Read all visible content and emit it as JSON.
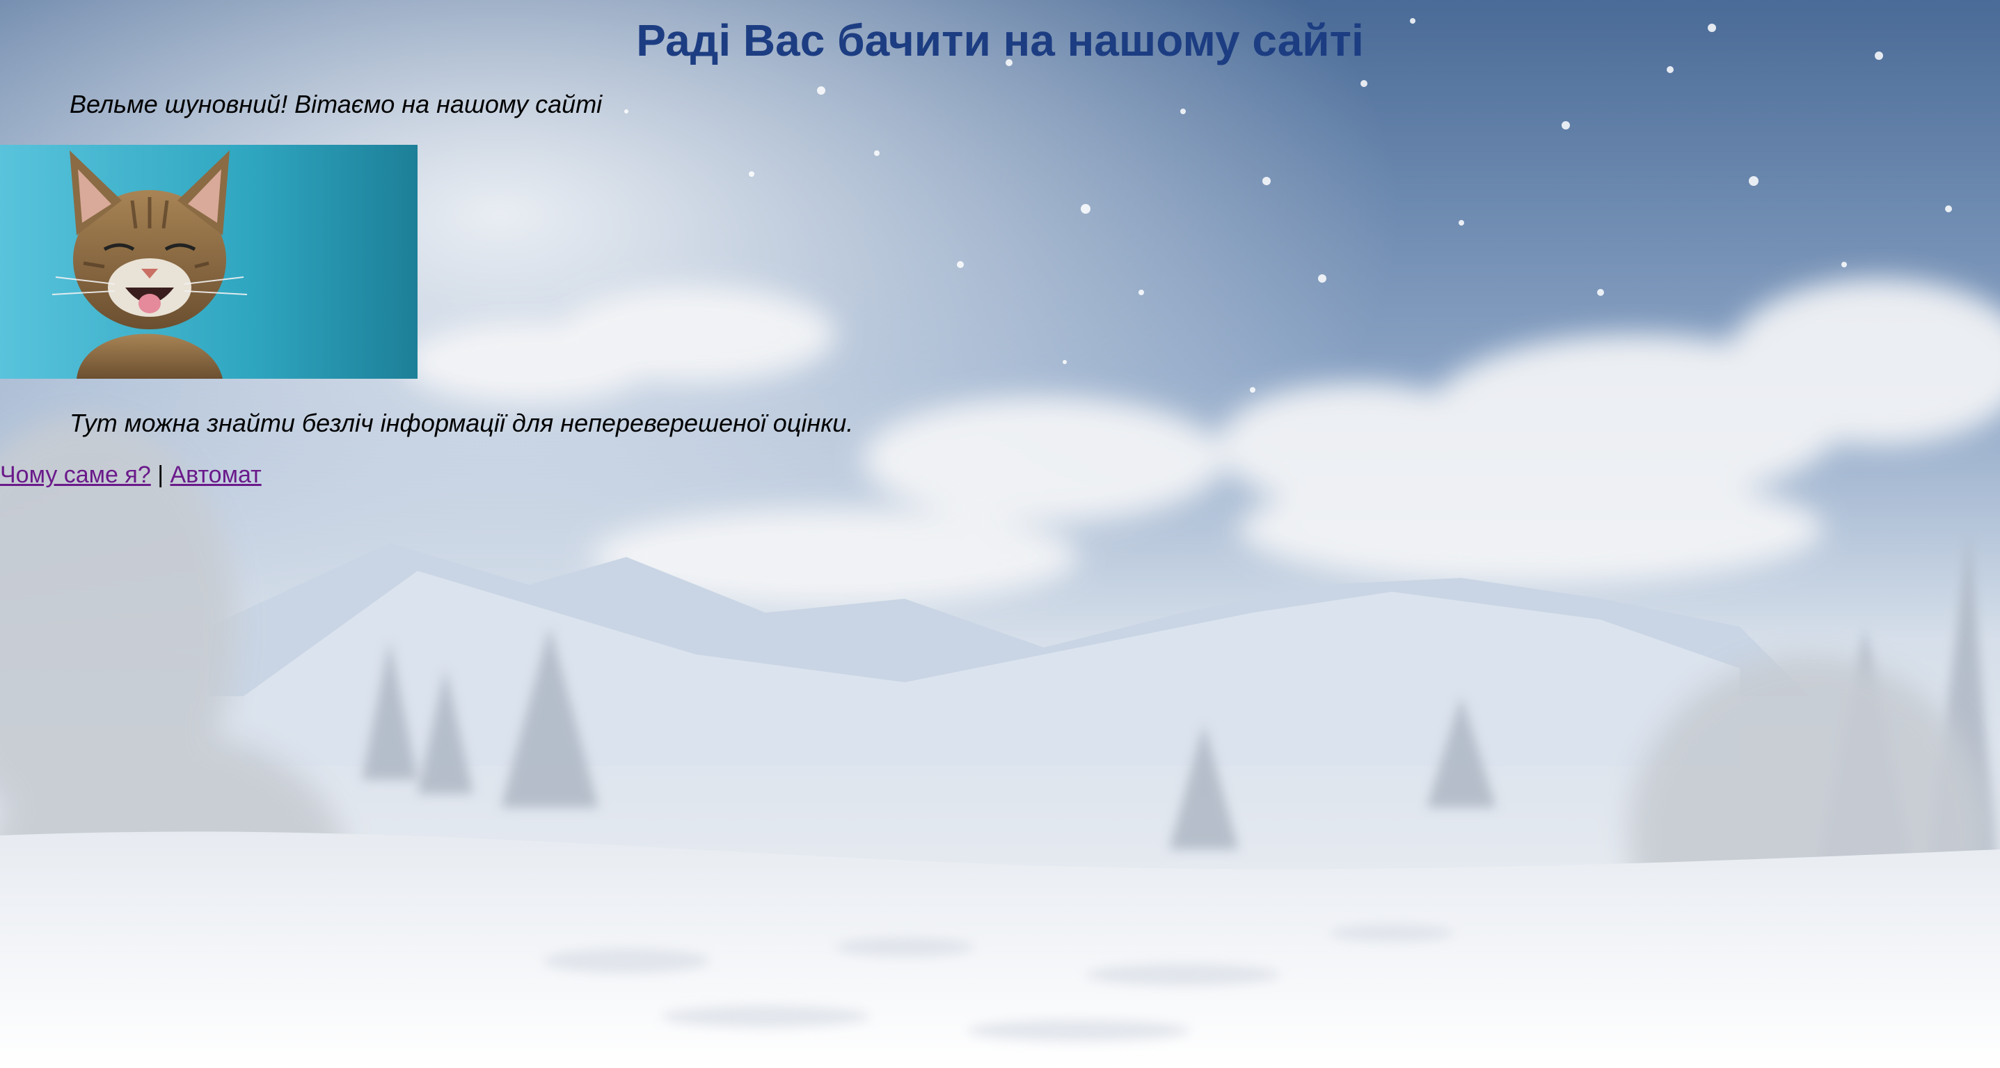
{
  "header": {
    "title": "Раді Вас бачити на нашому сайті"
  },
  "intro_text": "Вельме шуновний! Вітаємо на нашому сайті",
  "cat_image": {
    "icon": "smiling-cat-photo",
    "background_color": "#3cb3d0"
  },
  "info_text": "Тут можна знайти безліч інформації для непереверешеної оцінки.",
  "nav": {
    "links": [
      {
        "label": "Чому саме я?"
      },
      {
        "label": "Автомат"
      }
    ],
    "separator": "|"
  },
  "colors": {
    "title": "#1d3d82",
    "link_visited": "#6a1a8a",
    "text": "#000000"
  }
}
